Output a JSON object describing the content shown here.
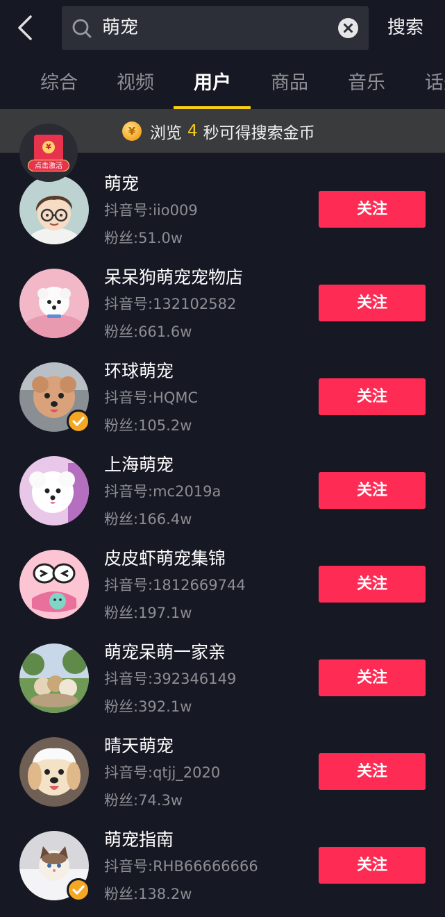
{
  "header": {
    "search_value": "萌宠",
    "search_button": "搜索"
  },
  "tabs": [
    {
      "label": "综合",
      "active": false
    },
    {
      "label": "视频",
      "active": false
    },
    {
      "label": "用户",
      "active": true
    },
    {
      "label": "商品",
      "active": false
    },
    {
      "label": "音乐",
      "active": false
    },
    {
      "label": "话题",
      "active": false
    }
  ],
  "banner": {
    "prefix": "浏览",
    "seconds": "4",
    "suffix": "秒可得搜索金币",
    "coin_icon": "coin-icon"
  },
  "red_packet": {
    "label": "点击激活",
    "yen": "¥"
  },
  "users": [
    {
      "name": "萌宠",
      "id": "抖音号:iio009",
      "fans": "粉丝:51.0w",
      "follow": "关注",
      "verified": false
    },
    {
      "name": "呆呆狗萌宠宠物店",
      "id": "抖音号:132102582",
      "fans": "粉丝:661.6w",
      "follow": "关注",
      "verified": false
    },
    {
      "name": "环球萌宠",
      "id": "抖音号:HQMC",
      "fans": "粉丝:105.2w",
      "follow": "关注",
      "verified": true
    },
    {
      "name": "上海萌宠",
      "id": "抖音号:mc2019a",
      "fans": "粉丝:166.4w",
      "follow": "关注",
      "verified": false
    },
    {
      "name": "皮皮虾萌宠集锦",
      "id": "抖音号:1812669744",
      "fans": "粉丝:197.1w",
      "follow": "关注",
      "verified": false
    },
    {
      "name": "萌宠呆萌一家亲",
      "id": "抖音号:392346149",
      "fans": "粉丝:392.1w",
      "follow": "关注",
      "verified": false
    },
    {
      "name": "晴天萌宠",
      "id": "抖音号:qtjj_2020",
      "fans": "粉丝:74.3w",
      "follow": "关注",
      "verified": false
    },
    {
      "name": "萌宠指南",
      "id": "抖音号:RHB66666666",
      "fans": "粉丝:138.2w",
      "follow": "关注",
      "verified": true
    }
  ],
  "colors": {
    "background": "#161823",
    "accent_red": "#fe2c55",
    "tab_indicator": "#face15",
    "verified": "#f5a623"
  }
}
